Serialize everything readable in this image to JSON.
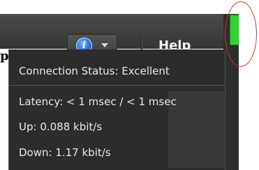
{
  "toolbar": {
    "help_label": "Help",
    "info_glyph": "i"
  },
  "side_label": "p",
  "popup": {
    "connection_status": "Connection Status: Excellent",
    "latency": "Latency: < 1 msec / < 1 msec",
    "up": "Up: 0.088 kbit/s",
    "down": "Down: 1.17 kbit/s"
  },
  "colors": {
    "signal": "#2ed52e",
    "annotation": "#c0392b",
    "info_blue": "#1a63d6"
  },
  "icons": [
    "info-icon",
    "chevron-down-icon",
    "signal-indicator-icon"
  ]
}
